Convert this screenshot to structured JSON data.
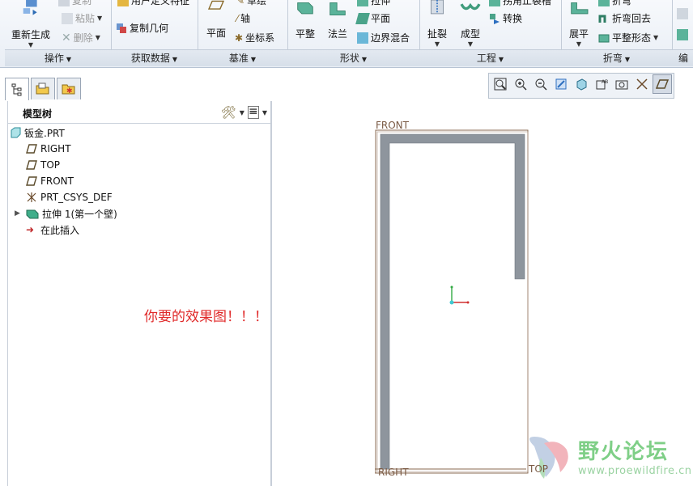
{
  "ribbon": {
    "groups": [
      {
        "label": "操作"
      },
      {
        "label": "获取数据"
      },
      {
        "label": "基准"
      },
      {
        "label": "形状"
      },
      {
        "label": "工程"
      },
      {
        "label": "折弯"
      },
      {
        "label": "编"
      }
    ],
    "operation": {
      "regenerate": "重新生成",
      "copy": "复制",
      "paste": "粘贴",
      "delete": "删除"
    },
    "getdata": {
      "user_defined": "用户定义特征",
      "copy_geometry": "复制几何"
    },
    "datum": {
      "plane": "平面",
      "point": "草绘",
      "axis": "轴",
      "csys": "坐标系"
    },
    "shape": {
      "flat": "平整",
      "flange": "法兰",
      "extrude": "拉伸",
      "plane": "平面",
      "blend": "边界混合"
    },
    "engineering": {
      "rip": "扯裂",
      "form": "成型",
      "corner": "拐角止裂槽",
      "convert": "转换"
    },
    "bend": {
      "unbend": "展平",
      "bend": "折弯",
      "bend_back": "折弯回去",
      "flatten": "平整形态"
    }
  },
  "model_tree": {
    "title": "模型树",
    "items": [
      {
        "label": "钣金.PRT",
        "icon": "part-icon"
      },
      {
        "label": "RIGHT",
        "icon": "datum-plane-icon"
      },
      {
        "label": "TOP",
        "icon": "datum-plane-icon"
      },
      {
        "label": "FRONT",
        "icon": "datum-plane-icon"
      },
      {
        "label": "PRT_CSYS_DEF",
        "icon": "csys-icon"
      },
      {
        "label": "拉伸 1(第一个壁)",
        "icon": "extrude-wall-icon"
      },
      {
        "label": "在此插入",
        "icon": "insert-here-arrow-icon"
      }
    ]
  },
  "annotation": "你要的效果图！！！",
  "graphics": {
    "datum_labels": {
      "front": "FRONT",
      "right": "RIGHT",
      "top": "TOP"
    }
  },
  "watermark": {
    "title": "野火论坛",
    "url": "www.proewildfire.cn"
  },
  "colors": {
    "annotation": "#e02a2a",
    "part_wall": "#8e959d",
    "datum": "#8a6a52",
    "watermark": "#7fcf87"
  }
}
